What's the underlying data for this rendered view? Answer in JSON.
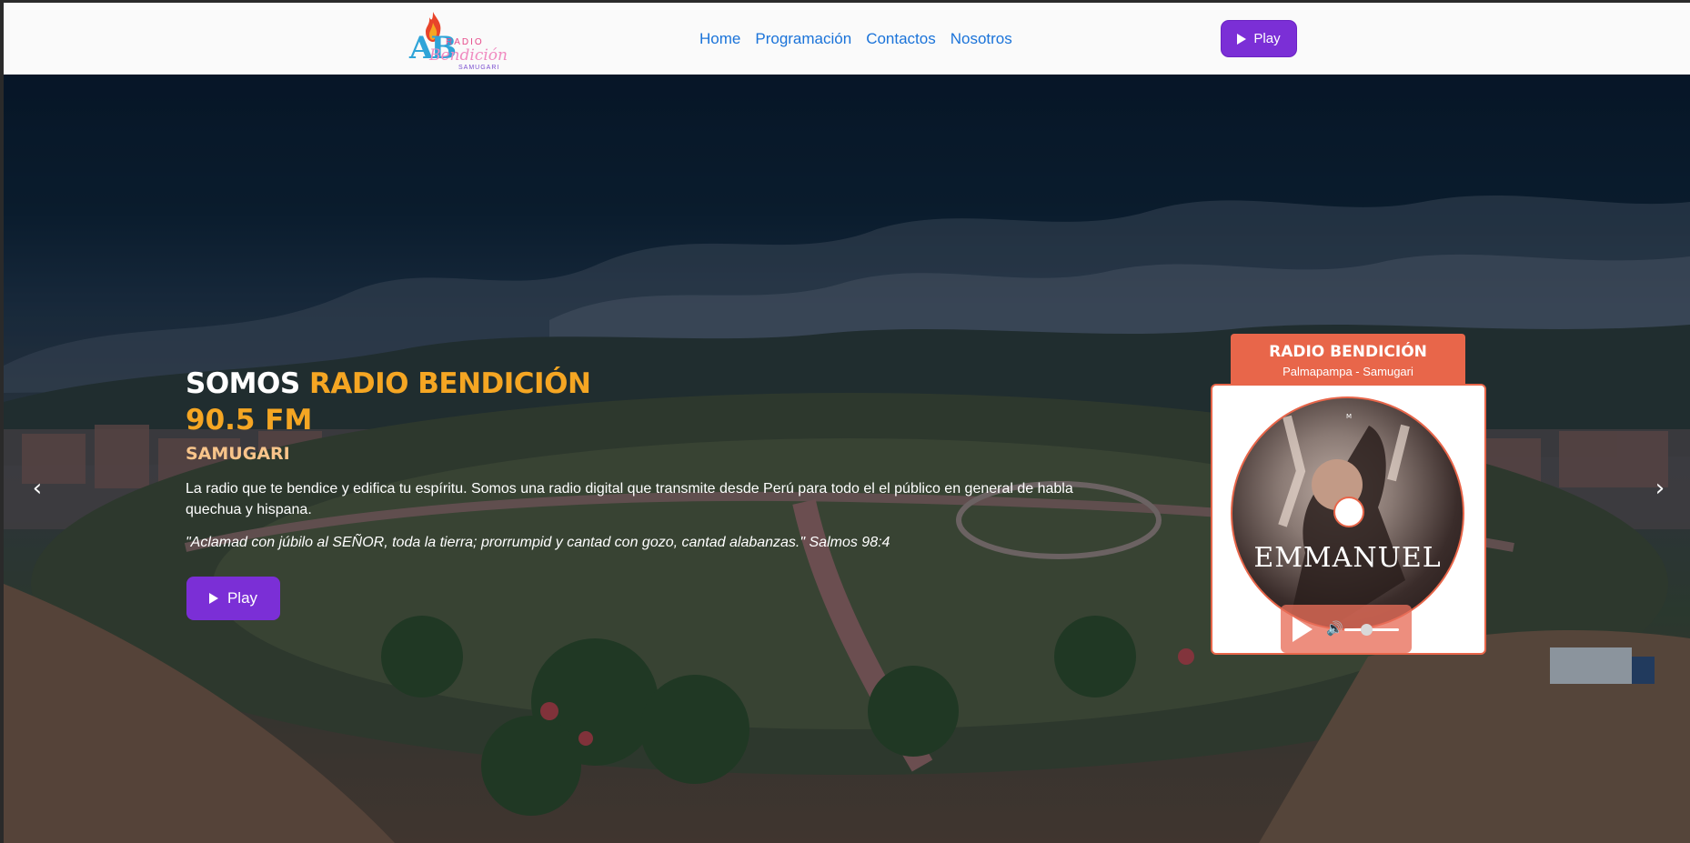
{
  "navbar": {
    "logo": {
      "mark": "AB",
      "radio": "RADIO",
      "script": "Bendición",
      "small": "SAMUGARI"
    },
    "links": [
      {
        "label": "Home"
      },
      {
        "label": "Programación"
      },
      {
        "label": "Contactos"
      },
      {
        "label": "Nosotros"
      }
    ],
    "play_label": "Play"
  },
  "hero": {
    "title_prefix": "SOMOS",
    "title_accent": "RADIO BENDICIÓN",
    "frequency": "90.5 FM",
    "town": "SAMUGARI",
    "description": "La radio que te bendice y edifica tu espíritu. Somos una radio digital que transmite desde Perú para todo el el público en general de habla quechua y hispana.",
    "verse": "\"Aclamad con júbilo al SEÑOR, toda la tierra; prorrumpid y cantad con gozo, cantad alabanzas.\" Salmos 98:4",
    "play_label": "Play",
    "prev_arrow": "‹",
    "next_arrow": "›"
  },
  "player": {
    "title": "RADIO BENDICIÓN",
    "subtitle": "Palmapampa - Samugari",
    "album_text": "EMMANUEL",
    "volume_icon": "🔊",
    "volume_level": 0.4
  },
  "colors": {
    "accent_purple": "#7b2fd6",
    "accent_orange": "#f5a623",
    "player_coral": "#e8664a",
    "link_blue": "#1a73d9"
  },
  "icons": {
    "play": "play-icon",
    "volume": "volume-icon",
    "prev": "chevron-left-icon",
    "next": "chevron-right-icon",
    "logo_flame": "flame-icon"
  }
}
